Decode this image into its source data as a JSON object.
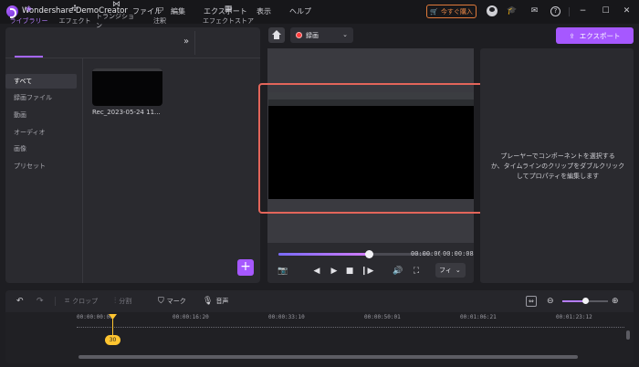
{
  "app": {
    "title": "Wondershare DemoCreator"
  },
  "menu": [
    "ファイル",
    "編集",
    "エクスポート",
    "表示",
    "ヘルプ"
  ],
  "titlebar": {
    "buy_label": "今すぐ購入"
  },
  "library": {
    "tabs": [
      {
        "label": "ライブラリー",
        "icon": "layers-icon"
      },
      {
        "label": "エフェクト",
        "icon": "effects-icon"
      },
      {
        "label": "トランジション",
        "icon": "transition-icon"
      },
      {
        "label": "注釈",
        "icon": "annotation-icon"
      },
      {
        "label": "エフェクトストア",
        "icon": "store-icon"
      }
    ],
    "sidebar": [
      "すべて",
      "録画ファイル",
      "動画",
      "オーディオ",
      "画像",
      "プリセット"
    ],
    "active_sidebar": "すべて",
    "media": [
      {
        "label": "Rec_2023-05-24 11..."
      }
    ]
  },
  "preview": {
    "record_label": "録画",
    "current_time": "00:00:06",
    "total_time": "00:00:08",
    "progress": 0.59,
    "fit_label": "フィ"
  },
  "properties": {
    "export_label": "エクスポート",
    "hint_line1": "プレーヤーでコンポーネントを選択する",
    "hint_line2": "か、タイムラインのクリップをダブルクリック",
    "hint_line3": "してプロパティを編集します"
  },
  "timeline": {
    "tools": {
      "crop": "クロップ",
      "split": "分割",
      "mark": "マーク",
      "voice": "音声"
    },
    "ruler": [
      "00:00:00:00",
      "00:00:16:20",
      "00:00:33:10",
      "00:00:50:01",
      "00:01:06:21",
      "00:01:23:12"
    ],
    "playhead_label": "30",
    "zoom_level": 0.5
  },
  "colors": {
    "accent": "#a658ff",
    "highlight": "#e3655a",
    "playhead": "#ffc530"
  }
}
